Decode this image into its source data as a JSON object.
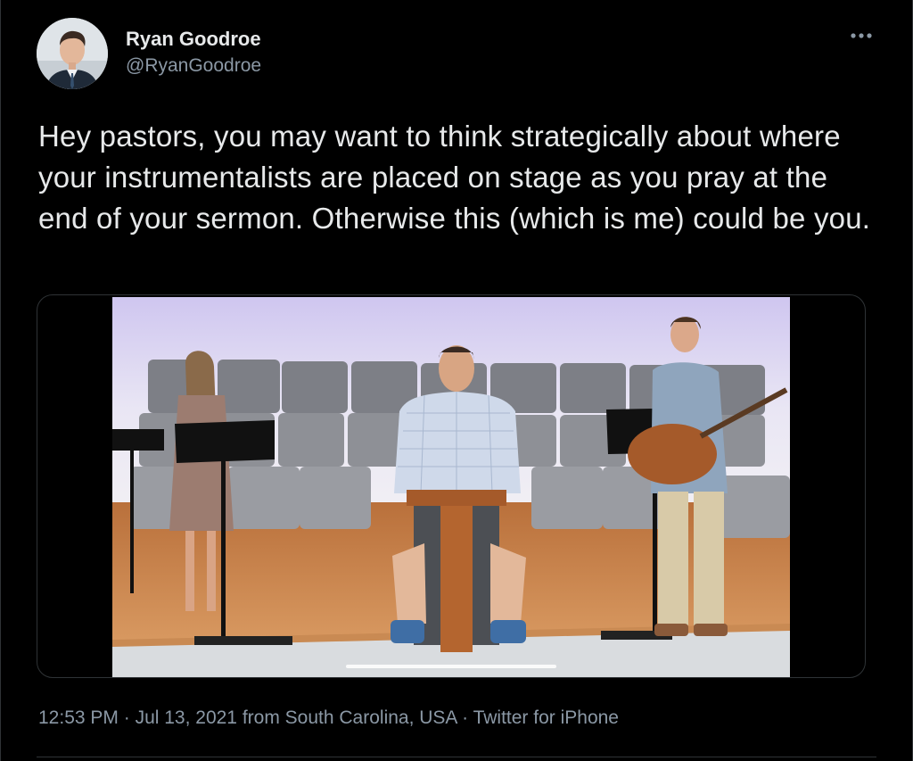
{
  "author": {
    "display_name": "Ryan Goodroe",
    "handle": "@RyanGoodroe"
  },
  "tweet": {
    "text": "Hey pastors, you may want to think strategically about where your instrumentalists are placed on stage as you pray at the end of your sermon. Otherwise this (which is me) could be you."
  },
  "meta": {
    "time": "12:53 PM",
    "separator_1": " · ",
    "date": "Jul 13, 2021",
    "location": " from South Carolina, USA",
    "separator_2": " · ",
    "source": "Twitter for iPhone"
  },
  "icons": {
    "more": "more-horizontal-icon"
  },
  "colors": {
    "background": "#000000",
    "text_primary": "#e7e9ea",
    "text_secondary": "#8b98a5",
    "border": "#2f3336"
  }
}
